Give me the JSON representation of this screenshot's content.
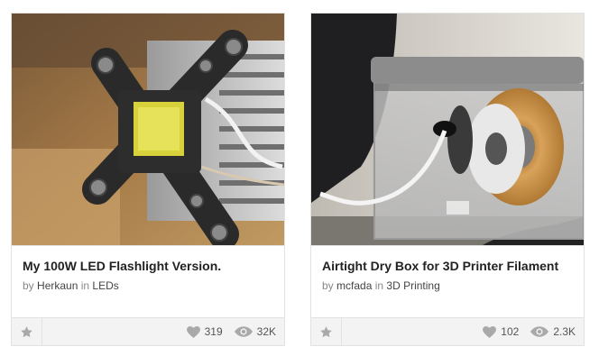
{
  "cards": [
    {
      "title": "My 100W LED Flashlight Version.",
      "by_label": "by",
      "author": "Herkaun",
      "in_label": "in",
      "category": "LEDs",
      "likes": "319",
      "views": "32K",
      "icons": {
        "favorite": "star-icon",
        "likes": "heart-icon",
        "views": "eye-icon"
      }
    },
    {
      "title": "Airtight Dry Box for 3D Printer Filament",
      "by_label": "by",
      "author": "mcfada",
      "in_label": "in",
      "category": "3D Printing",
      "likes": "102",
      "views": "2.3K",
      "icons": {
        "favorite": "star-icon",
        "likes": "heart-icon",
        "views": "eye-icon"
      }
    }
  ],
  "colors": {
    "card_border": "#e2e2e2",
    "footer_bg": "#f3f3f3",
    "icon_gray": "#a9a9a9",
    "title": "#222222"
  }
}
